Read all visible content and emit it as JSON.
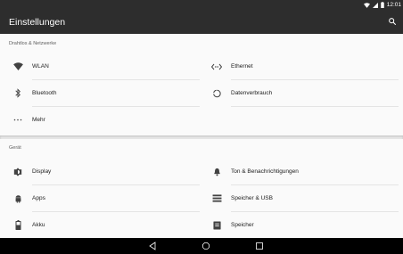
{
  "status_bar": {
    "time": "12:01",
    "icons": [
      "wifi-icon",
      "signal-icon",
      "battery-icon"
    ]
  },
  "app_bar": {
    "title": "Einstellungen",
    "search_icon": "search-icon"
  },
  "sections": [
    {
      "header": "Drahtlos & Netzwerke",
      "items": [
        {
          "label": "WLAN",
          "icon": "wifi-icon"
        },
        {
          "label": "Ethernet",
          "icon": "ethernet-icon"
        },
        {
          "label": "Bluetooth",
          "icon": "bluetooth-icon"
        },
        {
          "label": "Datenverbrauch",
          "icon": "data-usage-icon"
        },
        {
          "label": "Mehr",
          "icon": "more-icon"
        }
      ]
    },
    {
      "header": "Gerät",
      "items": [
        {
          "label": "Display",
          "icon": "display-icon"
        },
        {
          "label": "Ton & Benachrichtigungen",
          "icon": "bell-icon"
        },
        {
          "label": "Apps",
          "icon": "android-icon"
        },
        {
          "label": "Speicher & USB",
          "icon": "storage-icon"
        },
        {
          "label": "Akku",
          "icon": "battery-icon"
        },
        {
          "label": "Speicher",
          "icon": "memory-icon"
        }
      ]
    }
  ],
  "nav_bar": {
    "buttons": [
      "back-icon",
      "home-icon",
      "recents-icon"
    ]
  },
  "colors": {
    "app_bar": "#2d2d2d",
    "background": "#fafafa",
    "divider": "#e4e4e4",
    "nav_bar": "#000000"
  }
}
